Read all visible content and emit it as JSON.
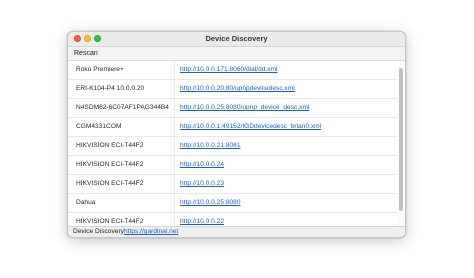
{
  "window": {
    "title": "Device Discovery"
  },
  "toolbar": {
    "rescan_label": "Rescan"
  },
  "devices": [
    {
      "name": "Roku Premiere+",
      "url": "http://10.0.0.171:8060/dial/dd.xml"
    },
    {
      "name": "ERI-K104-P4 10.0.0.20",
      "url": "http://10.0.0.20:80/upnpdevicedesc.xml"
    },
    {
      "name": "N4SDM62-6C07AF1PAG344B4",
      "url": "http://10.0.0.25:8080/upnp_device_desc.xml"
    },
    {
      "name": "CGM4331COM",
      "url": "http://10.0.0.1:49152/IGDdevicedesc_brlan0.xml"
    },
    {
      "name": "HIKVISION ECI-T44F2",
      "url": "http://10.0.0.21:8081"
    },
    {
      "name": "HIKVISION ECI-T44F2",
      "url": "http://10.0.0.24"
    },
    {
      "name": "HIKVISION ECI-T44F2",
      "url": "http://10.0.0.23"
    },
    {
      "name": "Dahua",
      "url": "http://10.0.0.25:8080"
    },
    {
      "name": "HIKVISION ECI-T44F2",
      "url": "http://10.0.0.22"
    }
  ],
  "statusbar": {
    "label": "Device Discovery",
    "link": "https://gardinal.net"
  },
  "colors": {
    "link": "#1a5fd0",
    "close": "#fe5f57",
    "minimize": "#febc2e",
    "zoom": "#28c840"
  }
}
